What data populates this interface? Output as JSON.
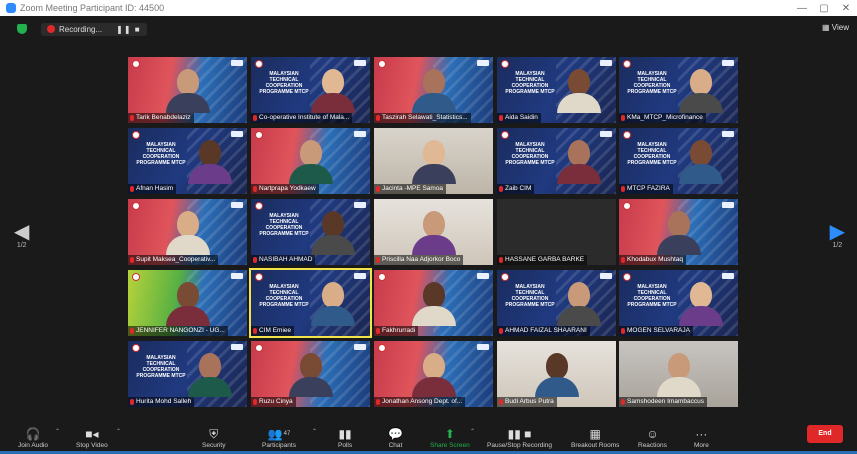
{
  "titlebar": {
    "title": "Zoom Meeting Participant ID: 44500",
    "minimize": "—",
    "maximize": "▢",
    "close": "✕"
  },
  "topbar": {
    "recording": "Recording...",
    "record_controls": "❚❚ ■",
    "view": "View"
  },
  "nav": {
    "page_left": "1/2",
    "page_right": "1/2",
    "arrow_left": "◀",
    "arrow_right": "▶"
  },
  "tiles": [
    {
      "name": "Tarik Benabdelaziz",
      "style": "bg-red"
    },
    {
      "name": "Co-operative Institute of Mala...",
      "style": "bg-poster"
    },
    {
      "name": "Taszirah Selawati_Statistics...",
      "style": "bg-red"
    },
    {
      "name": "Aida Saidin",
      "style": "bg-poster"
    },
    {
      "name": "KMa_MTCP_Microfinance",
      "style": "bg-poster"
    },
    {
      "name": "Afnan Hasim",
      "style": "bg-poster"
    },
    {
      "name": "Nartprapa Yodkaew",
      "style": "bg-red"
    },
    {
      "name": "Jacinta -MPE Samoa",
      "style": "bg-room"
    },
    {
      "name": "Zaib CIM",
      "style": "bg-poster"
    },
    {
      "name": "MTCP FAZIRA",
      "style": "bg-poster"
    },
    {
      "name": "Supit Maksea_Cooperativ...",
      "style": "bg-red"
    },
    {
      "name": "NASIBAH AHMAD",
      "style": "bg-poster"
    },
    {
      "name": "Priscilla Naa Adjorkor Boco",
      "style": "bg-wall"
    },
    {
      "name": "HASSANE GARBA BARKE",
      "style": "bg-dark"
    },
    {
      "name": "Khodabux Mushtaq",
      "style": "bg-red"
    },
    {
      "name": "JENNIFER NANGONZI - UG...",
      "style": "bg-green"
    },
    {
      "name": "CIM Emiee",
      "style": "bg-poster"
    },
    {
      "name": "Fakhrurradi",
      "style": "bg-red"
    },
    {
      "name": "AHMAD FAIZAL SHAARANI",
      "style": "bg-poster"
    },
    {
      "name": "MOGEN SELVARAJA",
      "style": "bg-poster"
    },
    {
      "name": "Hurita Mohd Salleh",
      "style": "bg-poster"
    },
    {
      "name": "Ruzu Cinya",
      "style": "bg-red"
    },
    {
      "name": "Jonathan Ansong Dept. of...",
      "style": "bg-red"
    },
    {
      "name": "Budi Arbus Putra",
      "style": "bg-wall"
    },
    {
      "name": "Samshodeen Imambaccus",
      "style": "bg-grey"
    }
  ],
  "poster_text": "MALAYSIAN TECHNICAL COOPERATION PROGRAMME MTCP",
  "toolbar": {
    "join_audio": "Join Audio",
    "stop_video": "Stop Video",
    "security": "Security",
    "participants": "Participants",
    "participants_count": "47",
    "polls": "Polls",
    "chat": "Chat",
    "share_screen": "Share Screen",
    "pause_recording": "Pause/Stop Recording",
    "breakout_rooms": "Breakout Rooms",
    "reactions": "Reactions",
    "more": "More",
    "end": "End"
  },
  "colors": {
    "accent": "#2d8cff",
    "share": "#23b04e",
    "end": "#e02828",
    "active_speaker": "#f2e34a"
  }
}
